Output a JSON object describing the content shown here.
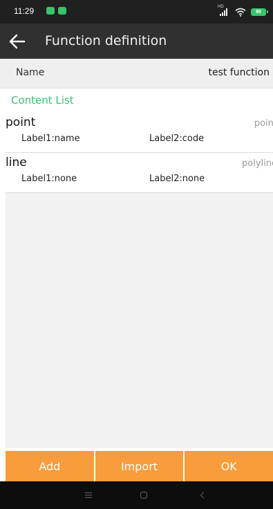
{
  "status_bar": {
    "time": "11:29",
    "battery": "90"
  },
  "app_bar": {
    "title": "Function definition"
  },
  "name_row": {
    "label": "Name",
    "value": "test function"
  },
  "content_list": {
    "header": "Content List",
    "items": [
      {
        "name": "point",
        "type": "point",
        "label1": "Label1:name",
        "label2": "Label2:code"
      },
      {
        "name": "line",
        "type": "polyline",
        "label1": "Label1:none",
        "label2": "Label2:none"
      }
    ]
  },
  "buttons": {
    "add": "Add",
    "import": "Import",
    "ok": "OK"
  },
  "colors": {
    "accent_green": "#3dbf73",
    "button_orange": "#f89c3c",
    "app_bar": "#303030"
  },
  "icons": [
    "back-arrow-icon",
    "signal-icon",
    "wifi-icon",
    "battery-icon",
    "menu-icon",
    "home-icon",
    "back-nav-icon"
  ]
}
